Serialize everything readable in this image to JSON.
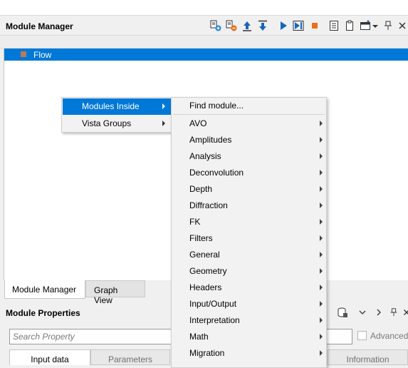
{
  "module_manager": {
    "title": "Module Manager",
    "tree": {
      "root_label": "Flow"
    },
    "tabs": [
      "Module Manager",
      "Graph View"
    ],
    "toolbar_icons": [
      "add-module-icon",
      "remove-module-icon",
      "move-up-icon",
      "move-down-icon",
      "run-icon",
      "run-step-icon",
      "stop-icon",
      "log-icon",
      "clipboard-icon",
      "window-icon",
      "dropdown-icon",
      "pin-icon",
      "close-icon"
    ]
  },
  "module_properties": {
    "title": "Module Properties",
    "search_placeholder": "Search Property",
    "advanced_label": "Advanced",
    "tabs": [
      "Input data",
      "Parameters",
      "Information"
    ]
  },
  "context_menu": {
    "items": [
      "Modules Inside",
      "Vista Groups"
    ],
    "selected": "Modules Inside"
  },
  "submenu": {
    "find_label": "Find module...",
    "items": [
      "AVO",
      "Amplitudes",
      "Analysis",
      "Deconvolution",
      "Depth",
      "Diffraction",
      "FK",
      "Filters",
      "General",
      "Geometry",
      "Headers",
      "Input/Output",
      "Interpretation",
      "Math",
      "Migration"
    ]
  },
  "colors": {
    "selection": "#0078d7",
    "stop": "#e8701a",
    "run": "#1565c0"
  }
}
